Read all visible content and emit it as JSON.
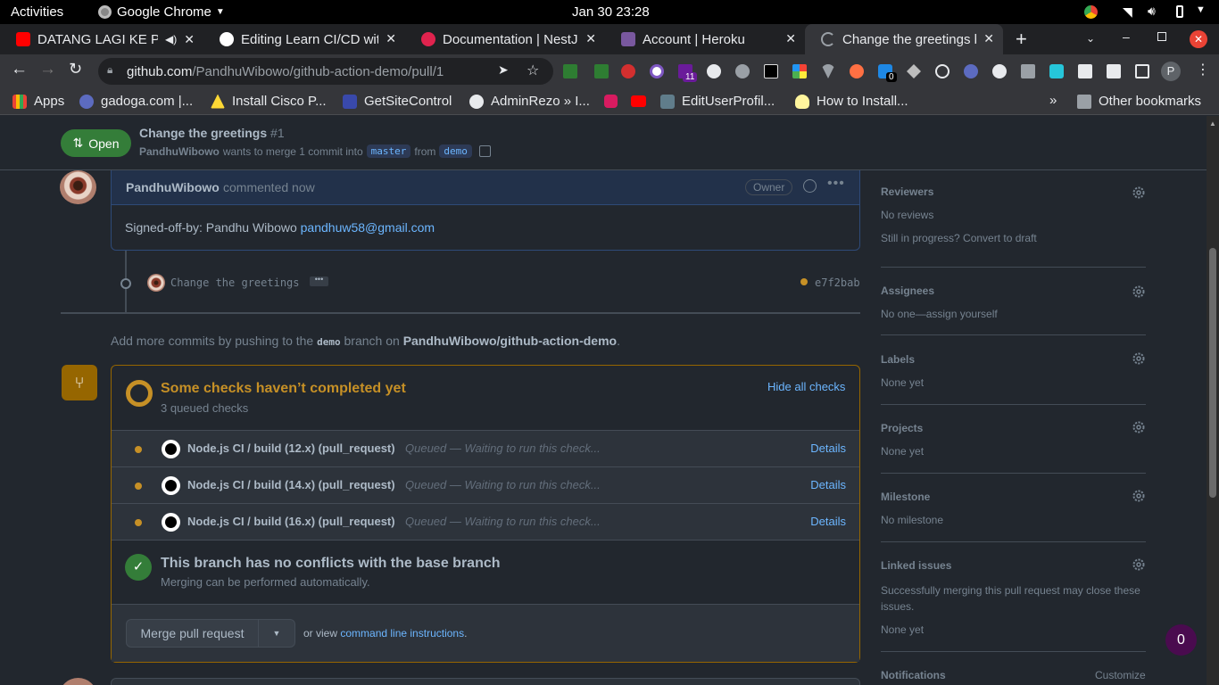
{
  "system": {
    "activities": "Activities",
    "app_name": "Google Chrome",
    "clock": "Jan 30  23:28"
  },
  "tabs": [
    {
      "title": "DATANG LAGI KE PE",
      "color": "#ff0000"
    },
    {
      "title": "Editing Learn CI/CD wit",
      "color": "#ffffff"
    },
    {
      "title": "Documentation | NestJ",
      "color": "#e0234e"
    },
    {
      "title": "Account | Heroku",
      "color": "#79589f"
    },
    {
      "title": "Change the greetings b",
      "color": "#444444"
    }
  ],
  "toolbar": {
    "url_host": "github.com",
    "url_path": "/PandhuWibowo/github-action-demo/pull/1",
    "badge_count": "11",
    "badge_count2": "0",
    "profile_initial": "P"
  },
  "bookmarks": [
    "Apps",
    "gadoga.com |...",
    "Install Cisco P...",
    "GetSiteControl",
    "AdminRezo » I...",
    "EditUserProfil...",
    "How to Install...",
    "Other bookmarks"
  ],
  "pr": {
    "status": "Open",
    "title": "Change the greetings",
    "number": "#1",
    "author": "PandhuWibowo",
    "merge_text": "wants to merge 1 commit into",
    "base": "master",
    "from": "from",
    "head": "demo"
  },
  "comment": {
    "author": "PandhuWibowo",
    "time": "commented now",
    "role": "Owner",
    "body_prefix": "Signed-off-by: Pandhu Wibowo",
    "email": "pandhuw58@gmail.com"
  },
  "commit": {
    "message": "Change the greetings",
    "sha": "e7f2bab"
  },
  "push_hint": {
    "prefix": "Add more commits by pushing to the",
    "branch": "demo",
    "middle": "branch on",
    "repo": "PandhuWibowo/github-action-demo",
    "suffix": "."
  },
  "checks": {
    "title": "Some checks haven’t completed yet",
    "subtitle": "3 queued checks",
    "hide_label": "Hide all checks",
    "items": [
      {
        "name": "Node.js CI / build (12.x) (pull_request)",
        "status": "Queued — Waiting to run this check...",
        "details": "Details"
      },
      {
        "name": "Node.js CI / build (14.x) (pull_request)",
        "status": "Queued — Waiting to run this check...",
        "details": "Details"
      },
      {
        "name": "Node.js CI / build (16.x) (pull_request)",
        "status": "Queued — Waiting to run this check...",
        "details": "Details"
      }
    ]
  },
  "merge": {
    "conflict_title": "This branch has no conflicts with the base branch",
    "conflict_sub": "Merging can be performed automatically.",
    "button": "Merge pull request",
    "or_view": "or view",
    "cli_link": "command line instructions",
    "period": "."
  },
  "sidebar": {
    "reviewers": {
      "label": "Reviewers",
      "value": "No reviews",
      "extra": "Still in progress? Convert to draft"
    },
    "assignees": {
      "label": "Assignees",
      "value": "No one—assign yourself"
    },
    "labels": {
      "label": "Labels",
      "value": "None yet"
    },
    "projects": {
      "label": "Projects",
      "value": "None yet"
    },
    "milestone": {
      "label": "Milestone",
      "value": "No milestone"
    },
    "linked": {
      "label": "Linked issues",
      "desc": "Successfully merging this pull request may close these issues.",
      "value": "None yet"
    },
    "notifications": {
      "label": "Notifications",
      "action": "Customize"
    }
  },
  "floating_badge": "0"
}
